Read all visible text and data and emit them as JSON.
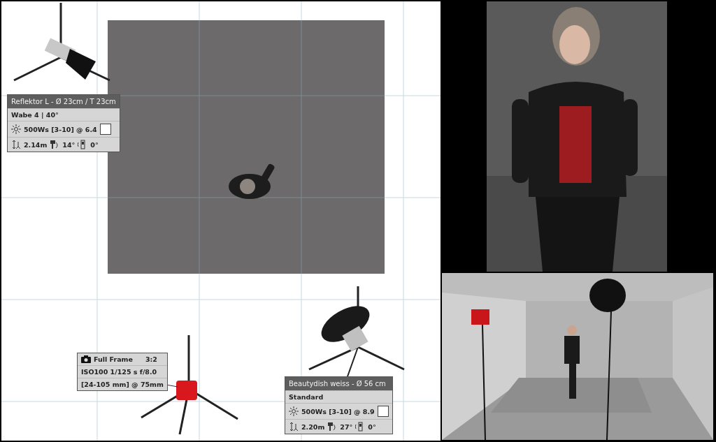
{
  "lights": [
    {
      "title": "Reflektor L - Ø 23cm / T 23cm",
      "modifier": "Wabe 4 | 40°",
      "power": "500Ws [3-10] @ 6.4",
      "height": "2.14m",
      "tilt": "14°",
      "roll": "0°"
    },
    {
      "title": "Beautydish weiss - Ø 56 cm",
      "modifier": "Standard",
      "power": "500Ws [3-10] @ 8.9",
      "height": "2.20m",
      "tilt": "27°",
      "roll": "0°"
    }
  ],
  "camera": {
    "format": "Full Frame",
    "ratio": "3:2",
    "exposure": "ISO100 1/125 s f/8.0",
    "lens": "[24-105 mm] @ 75mm"
  }
}
